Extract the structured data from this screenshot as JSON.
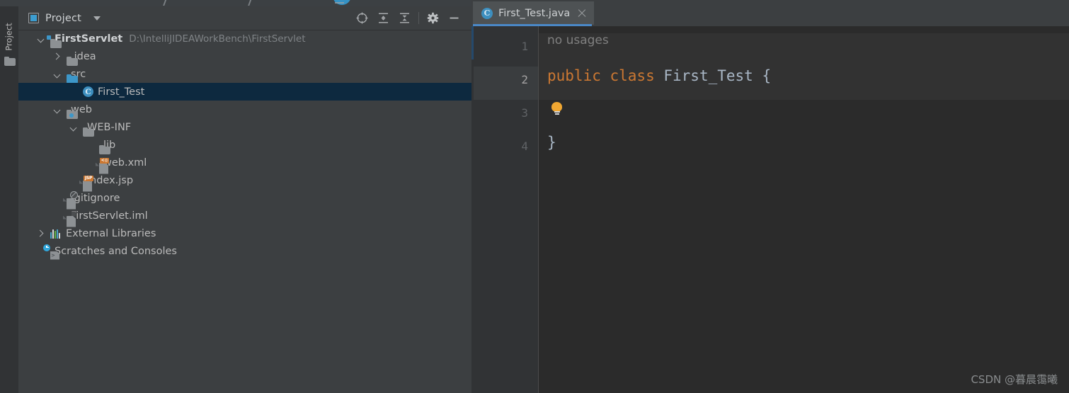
{
  "window": {
    "left_tool_strip": {
      "vertical_tab_label": "Project",
      "folder_icon": "folder-icon"
    }
  },
  "project_panel": {
    "title": "Project",
    "title_icon": "project-view-icon",
    "dropdown_icon": "chevron-down-icon",
    "actions": [
      {
        "name": "select-opened-file-icon",
        "tooltip": "Select Opened File"
      },
      {
        "name": "expand-all-icon",
        "tooltip": "Expand All"
      },
      {
        "name": "collapse-all-icon",
        "tooltip": "Collapse All"
      },
      {
        "name": "settings-gear-icon",
        "tooltip": "Options"
      },
      {
        "name": "hide-icon",
        "tooltip": "Hide"
      }
    ],
    "tree": [
      {
        "label": "FirstServlet",
        "path": "D:\\IntelliJIDEAWorkBench\\FirstServlet",
        "icon": "module-folder-icon",
        "twisty": "down",
        "indent": 0,
        "bold": true,
        "selected": false
      },
      {
        "label": ".idea",
        "path": "",
        "icon": "folder-icon",
        "twisty": "right",
        "indent": 1,
        "bold": false,
        "selected": false
      },
      {
        "label": "src",
        "path": "",
        "icon": "source-folder-icon",
        "twisty": "down",
        "indent": 1,
        "bold": false,
        "selected": false
      },
      {
        "label": "First_Test",
        "path": "",
        "icon": "java-class-icon",
        "twisty": "none",
        "indent": 2,
        "bold": false,
        "selected": true
      },
      {
        "label": "web",
        "path": "",
        "icon": "web-resource-folder-icon",
        "twisty": "down",
        "indent": 1,
        "bold": false,
        "selected": false
      },
      {
        "label": "WEB-INF",
        "path": "",
        "icon": "folder-icon",
        "twisty": "down",
        "indent": 2,
        "bold": false,
        "selected": false
      },
      {
        "label": "lib",
        "path": "",
        "icon": "folder-icon",
        "twisty": "none",
        "indent": 3,
        "bold": false,
        "selected": false
      },
      {
        "label": "web.xml",
        "path": "",
        "icon": "xml-file-icon",
        "twisty": "none",
        "indent": 3,
        "bold": false,
        "selected": false
      },
      {
        "label": "index.jsp",
        "path": "",
        "icon": "jsp-file-icon",
        "twisty": "none",
        "indent": 2,
        "bold": false,
        "selected": false
      },
      {
        "label": ".gitignore",
        "path": "",
        "icon": "gitignore-file-icon",
        "twisty": "none",
        "indent": 1,
        "bold": false,
        "selected": false
      },
      {
        "label": "FirstServlet.iml",
        "path": "",
        "icon": "iml-file-icon",
        "twisty": "none",
        "indent": 1,
        "bold": false,
        "selected": false
      },
      {
        "label": "External Libraries",
        "path": "",
        "icon": "external-libraries-icon",
        "twisty": "right",
        "indent": 0,
        "bold": false,
        "selected": false
      },
      {
        "label": "Scratches and Consoles",
        "path": "",
        "icon": "scratches-icon",
        "twisty": "none",
        "indent": 0,
        "bold": false,
        "selected": false
      }
    ]
  },
  "editor": {
    "tabs": [
      {
        "label": "First_Test.java",
        "icon": "java-class-icon",
        "close_icon": "close-icon",
        "active": true
      }
    ],
    "gutter_line_numbers": [
      "1",
      "2",
      "3",
      "4"
    ],
    "caret_line": "2",
    "inlay_hint": "no usages",
    "intention_icon": "lightbulb-icon",
    "code_lines": [
      {
        "number": "1",
        "tokens": [
          {
            "text": "public class ",
            "type": "keyword"
          },
          {
            "text": "First_Test ",
            "type": "classname"
          },
          {
            "text": "{",
            "type": "brace"
          }
        ]
      },
      {
        "number": "2",
        "tokens": []
      },
      {
        "number": "3",
        "tokens": [
          {
            "text": "}",
            "type": "brace"
          }
        ]
      },
      {
        "number": "4",
        "tokens": []
      }
    ]
  },
  "watermark": "CSDN @暮晨霭曦",
  "colors": {
    "panel_bg": "#3c3f41",
    "gutter_bg": "#313335",
    "editor_bg": "#2b2b2b",
    "selection_bg": "#0d293f",
    "tab_active_underline": "#4a88c7",
    "keyword": "#cc7832",
    "classname": "#a9b7c6",
    "hint_text": "#808080",
    "source_folder": "#3d97c9",
    "badge_orange": "#cc7832"
  }
}
